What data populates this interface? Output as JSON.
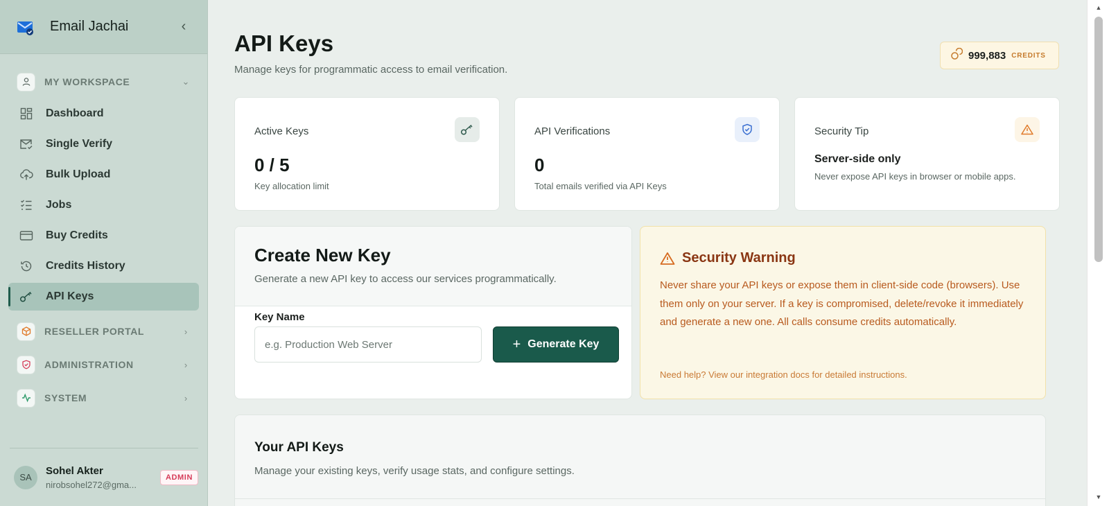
{
  "brand": {
    "name": "Email Jachai"
  },
  "sidebar": {
    "workspace_label": "MY WORKSPACE",
    "items": [
      {
        "label": "Dashboard",
        "icon": "grid-icon"
      },
      {
        "label": "Single Verify",
        "icon": "mail-check-icon"
      },
      {
        "label": "Bulk Upload",
        "icon": "cloud-upload-icon"
      },
      {
        "label": "Jobs",
        "icon": "list-checks-icon"
      },
      {
        "label": "Buy Credits",
        "icon": "credit-card-icon"
      },
      {
        "label": "Credits History",
        "icon": "history-icon"
      },
      {
        "label": "API Keys",
        "icon": "key-icon",
        "active": true
      }
    ],
    "groups": [
      {
        "label": "RESELLER PORTAL",
        "icon": "box-icon"
      },
      {
        "label": "ADMINISTRATION",
        "icon": "shield-icon"
      },
      {
        "label": "SYSTEM",
        "icon": "activity-icon"
      }
    ],
    "user": {
      "initials": "SA",
      "name": "Sohel Akter",
      "email": "nirobsohel272@gma...",
      "role": "ADMIN"
    }
  },
  "header": {
    "title": "API Keys",
    "subtitle": "Manage keys for programmatic access to email verification.",
    "credits_value": "999,883",
    "credits_label": "CREDITS"
  },
  "stats": {
    "active_keys": {
      "title": "Active Keys",
      "value": "0 / 5",
      "caption": "Key allocation limit"
    },
    "api_verifications": {
      "title": "API Verifications",
      "value": "0",
      "caption": "Total emails verified via API Keys"
    },
    "security_tip": {
      "title": "Security Tip",
      "heading": "Server-side only",
      "text": "Never expose API keys in browser or mobile apps."
    }
  },
  "create_key": {
    "title": "Create New Key",
    "subtitle": "Generate a new API key to access our services programmatically.",
    "field_label": "Key Name",
    "placeholder": "e.g. Production Web Server",
    "value": "",
    "button_label": "Generate Key"
  },
  "security_warning": {
    "title": "Security Warning",
    "body": "Never share your API keys or expose them in client-side code (browsers). Use them only on your server. If a key is compromised, delete/revoke it immediately and generate a new one. All calls consume credits automatically.",
    "help_link": "Need help? View our integration docs for detailed instructions."
  },
  "your_keys": {
    "title": "Your API Keys",
    "subtitle": "Manage your existing keys, verify usage stats, and configure settings."
  },
  "colors": {
    "accent": "#1a5a4b",
    "sidebar_bg": "#cbdad3",
    "warning_text": "#b85a1e",
    "warning_bg": "#fbf7e6",
    "admin_badge": "#d63b58"
  }
}
